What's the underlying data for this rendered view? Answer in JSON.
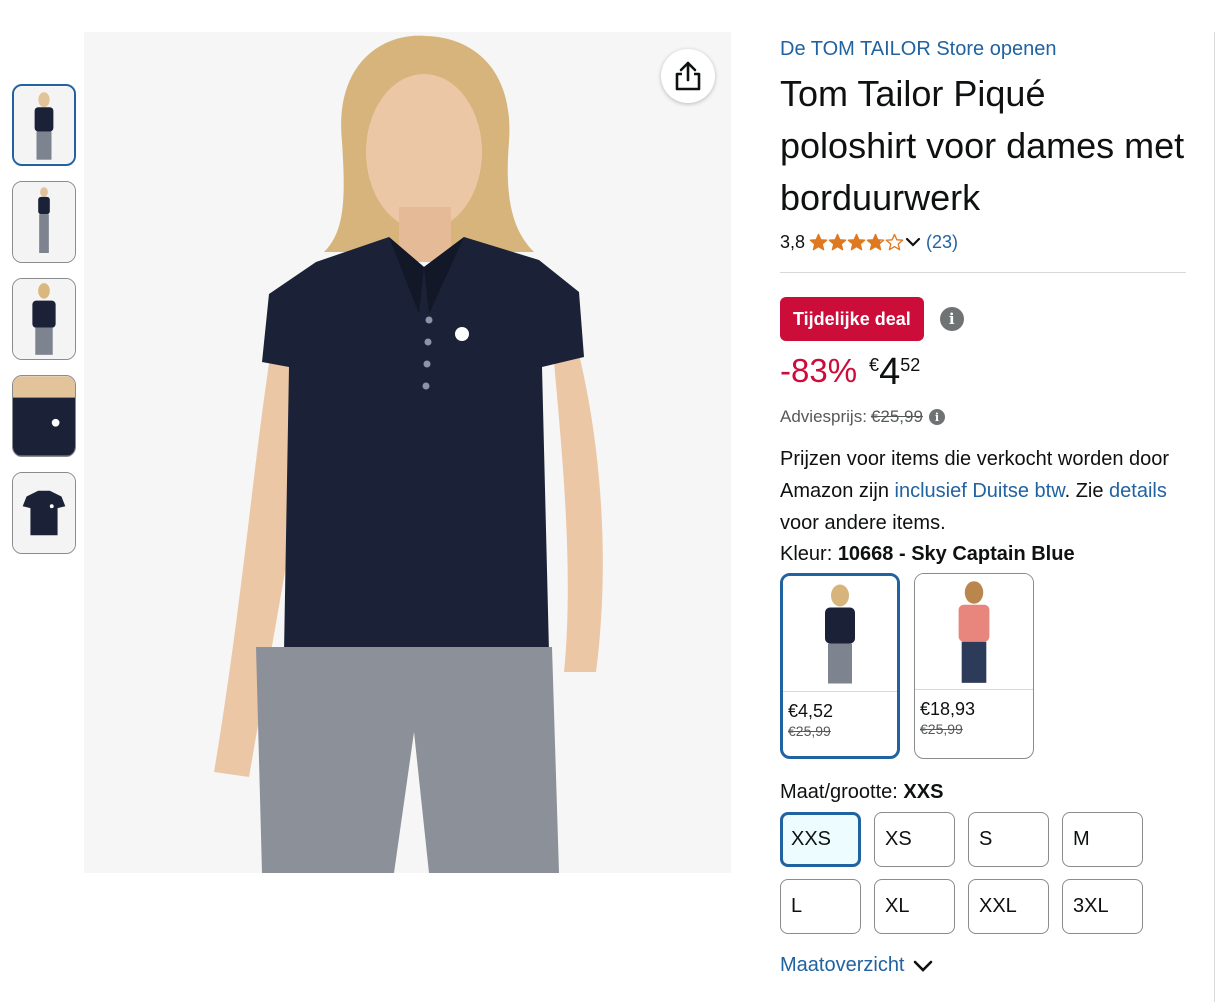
{
  "thumbnails": [
    {
      "name": "front-view",
      "selected": true
    },
    {
      "name": "full-body-view",
      "selected": false
    },
    {
      "name": "back-view",
      "selected": false
    },
    {
      "name": "detail-view",
      "selected": false
    },
    {
      "name": "flat-lay-view",
      "selected": false
    }
  ],
  "main_image": {
    "alt_icon": "product-photo"
  },
  "share": {
    "icon": "share-icon"
  },
  "store_link": "De TOM TAILOR Store openen",
  "title": "Tom Tailor Piqué poloshirt voor dames met borduurwerk",
  "rating": {
    "value": "3,8",
    "stars": 3.8,
    "count": "(23)"
  },
  "deal_badge": "Tijdelijke deal",
  "price": {
    "discount": "-83%",
    "currency": "€",
    "whole": "4",
    "fraction": "52"
  },
  "list_price": {
    "label": "Adviesprijs:",
    "value": "€25,99"
  },
  "vat": {
    "part1": "Prijzen voor items die verkocht worden door Amazon zijn ",
    "link1": "inclusief Duitse btw",
    "part2": ". Zie ",
    "link2": "details",
    "part3": " voor andere items."
  },
  "color": {
    "label": "Kleur:",
    "value": "10668 - Sky Captain Blue"
  },
  "swatches": [
    {
      "price": "€4,52",
      "list_price": "€25,99",
      "selected": true,
      "shirt_color": "#1b2237"
    },
    {
      "price": "€18,93",
      "list_price": "€25,99",
      "selected": false,
      "shirt_color": "#e8857c"
    }
  ],
  "size": {
    "label": "Maat/grootte:",
    "value": "XXS"
  },
  "sizes": [
    "XXS",
    "XS",
    "S",
    "M",
    "L",
    "XL",
    "XXL",
    "3XL"
  ],
  "size_chart": "Maatoverzicht",
  "colors": {
    "link": "#2162a1",
    "deal": "#cc0c39",
    "star": "#de7921"
  }
}
